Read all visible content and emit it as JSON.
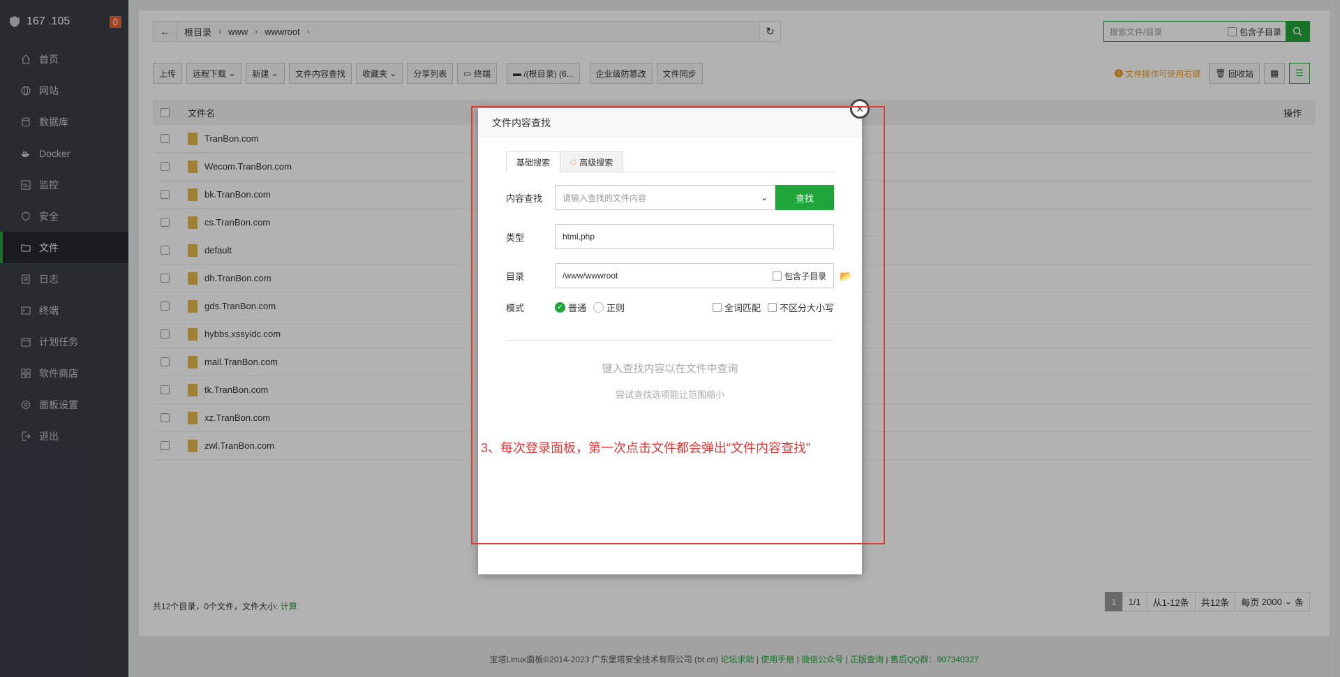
{
  "sidebar": {
    "ip": "167 .105",
    "badge": "0",
    "items": [
      {
        "label": "首页"
      },
      {
        "label": "网站"
      },
      {
        "label": "数据库"
      },
      {
        "label": "Docker"
      },
      {
        "label": "监控"
      },
      {
        "label": "安全"
      },
      {
        "label": "文件"
      },
      {
        "label": "日志"
      },
      {
        "label": "终端"
      },
      {
        "label": "计划任务"
      },
      {
        "label": "软件商店"
      },
      {
        "label": "面板设置"
      },
      {
        "label": "退出"
      }
    ]
  },
  "pathbar": {
    "crumbs": [
      "根目录",
      "www",
      "wwwroot"
    ]
  },
  "search": {
    "placeholder": "搜索文件/目录",
    "include_sub": "包含子目录"
  },
  "toolbar": {
    "upload": "上传",
    "remote_download": "远程下载",
    "new": "新建",
    "content_search": "文件内容查找",
    "favorites": "收藏夹",
    "share_list": "分享列表",
    "terminal": "终端",
    "disk": "/(根目录) (6...",
    "tamper": "企业级防篡改",
    "sync": "文件同步",
    "tip": "文件操作可使用右键",
    "recycle": "回收站"
  },
  "table": {
    "col_name": "文件名",
    "col_ops": "操作",
    "rows": [
      "TranBon.com",
      "Wecom.TranBon.com",
      "bk.TranBon.com",
      "cs.TranBon.com",
      "default",
      "dh.TranBon.com",
      "gds.TranBon.com",
      "hybbs.xssyidc.com",
      "mail.TranBon.com",
      "tk.TranBon.com",
      "xz.TranBon.com",
      "zwl.TranBon.com"
    ]
  },
  "footer": {
    "summary": "共12个目录，0个文件，文件大小:",
    "calc": "计算"
  },
  "pager": {
    "page": "1",
    "pages": "1/1",
    "range": "从1-12条",
    "total": "共12条",
    "per_page_label": "每页",
    "per_page": "2000",
    "unit": "条"
  },
  "copyright": {
    "text": "宝塔Linux面板©2014-2023 广东堡塔安全技术有限公司 (bt.cn)",
    "links": [
      "论坛求助",
      "使用手册",
      "微信公众号",
      "正版查询",
      "售后QQ群：907340327"
    ]
  },
  "modal": {
    "title": "文件内容查找",
    "tab_basic": "基础搜索",
    "tab_advanced": "高级搜索",
    "content_label": "内容查找",
    "content_placeholder": "请输入查找的文件内容",
    "search_btn": "查找",
    "type_label": "类型",
    "type_value": "html,php",
    "dir_label": "目录",
    "dir_value": "/www/wwwroot",
    "include_sub": "包含子目录",
    "mode_label": "模式",
    "mode_normal": "普通",
    "mode_regex": "正则",
    "whole_word": "全词匹配",
    "ignore_case": "不区分大小写",
    "empty_main": "键入查找内容以在文件中查询",
    "empty_sub": "尝试查找选项能让范围缩小"
  },
  "annotation": "3、每次登录面板，第一次点击文件都会弹出“文件内容查找”"
}
